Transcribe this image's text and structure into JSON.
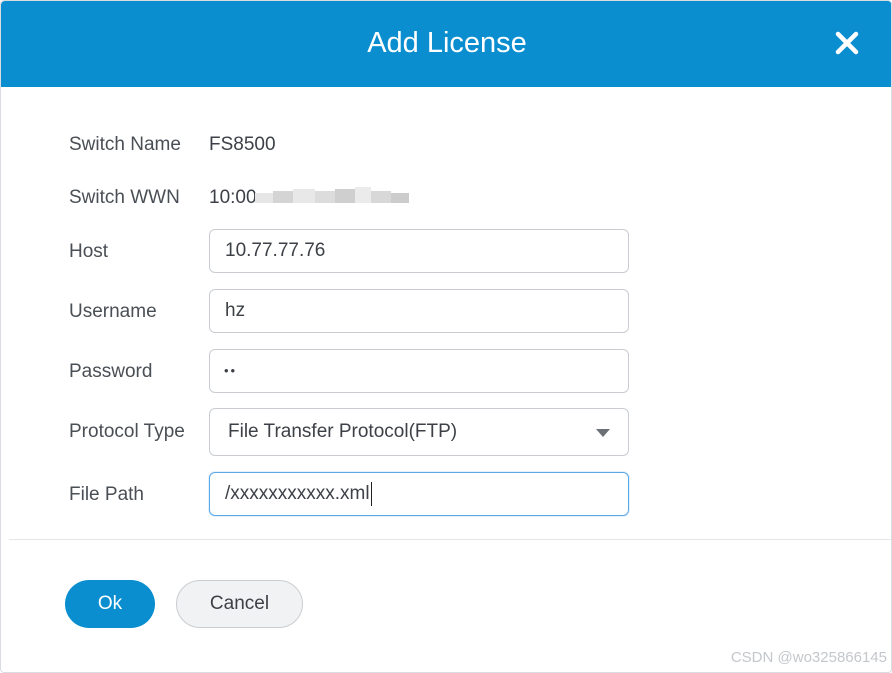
{
  "dialog": {
    "title": "Add License",
    "close_icon": "close-icon"
  },
  "form": {
    "switch_name": {
      "label": "Switch Name",
      "value": "FS8500"
    },
    "switch_wwn": {
      "label": "Switch WWN",
      "value": "10:00"
    },
    "host": {
      "label": "Host",
      "value": "10.77.77.76"
    },
    "username": {
      "label": "Username",
      "value": "hz"
    },
    "password": {
      "label": "Password",
      "value": "••"
    },
    "protocol": {
      "label": "Protocol Type",
      "value": "File Transfer Protocol(FTP)",
      "icon": "chevron-down-icon"
    },
    "file_path": {
      "label": "File Path",
      "value": "/xxxxxxxxxxx.xml"
    }
  },
  "actions": {
    "ok_label": "Ok",
    "cancel_label": "Cancel"
  },
  "watermark": "CSDN @wo325866145",
  "colors": {
    "header": "#0a8ed0",
    "primary_button": "#0a8ed0",
    "focus_border": "#5aa8e6"
  }
}
